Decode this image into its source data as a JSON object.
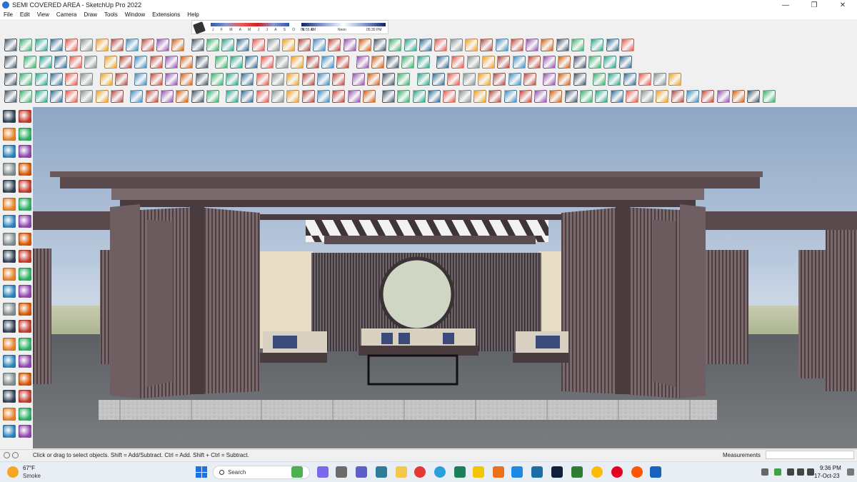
{
  "window": {
    "title": "SEMI COVERED AREA - SketchUp Pro 2022",
    "minimize_glyph": "—",
    "maximize_glyph": "❐",
    "close_glyph": "✕"
  },
  "menu": [
    "File",
    "Edit",
    "View",
    "Camera",
    "Draw",
    "Tools",
    "Window",
    "Extensions",
    "Help"
  ],
  "shadow_settings": {
    "months": "J F M A M J J A S O N D",
    "time_start": "06:55 AM",
    "time_noon": "Noon",
    "time_end": "05:30 PM"
  },
  "status": {
    "hint": "Click or drag to select objects. Shift = Add/Subtract. Ctrl = Add. Shift + Ctrl = Subtract.",
    "measurements_label": "Measurements",
    "measurements_value": ""
  },
  "taskbar": {
    "temperature": "67°F",
    "weather": "Smoke",
    "search_placeholder": "Search",
    "time": "9:36 PM",
    "date": "17-Oct-23"
  },
  "colors": {
    "accent": "#2a6fd6",
    "wood": "#6b5a5c",
    "wood_dark": "#4a3b3f",
    "sky": "#b9c9dd",
    "floor": "#6e7175",
    "plinth": "#c9c9c9"
  }
}
